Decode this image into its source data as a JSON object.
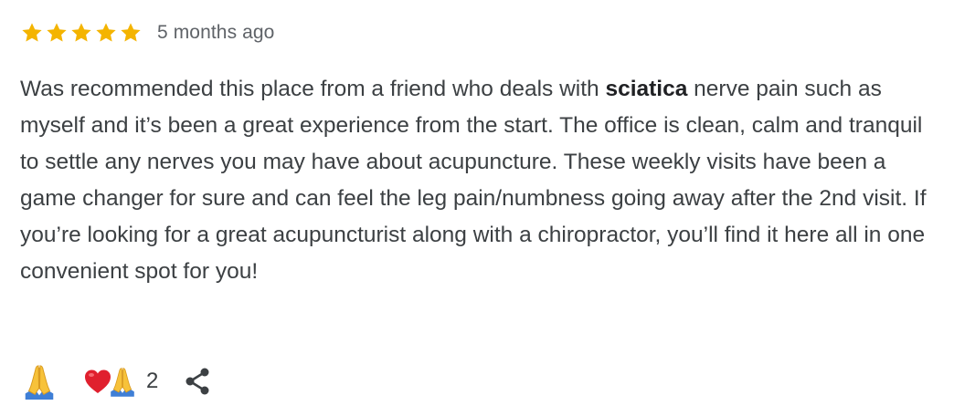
{
  "review": {
    "rating": 5,
    "max_rating": 5,
    "star_color": "#f4b400",
    "date": "5 months ago",
    "text_before_bold": "Was recommended this place from a friend who deals with ",
    "bold_text": "sciatica",
    "text_after_bold": " nerve pain such as myself and it’s been a great experience from the start. The office is clean, calm and tranquil to settle any nerves you may have about acupuncture. These weekly visits have been a game changer for sure and can feel the leg pain/numbness going away after the 2nd visit. If you’re looking for a great acupuncturist along with a chiropractor, you’ll find it here all in one convenient spot for you!"
  },
  "actions": {
    "react_icon": "folded-hands-icon",
    "reaction_icons": [
      "heart-icon",
      "folded-hands-icon"
    ],
    "reaction_count": "2",
    "share_icon": "share-icon"
  }
}
